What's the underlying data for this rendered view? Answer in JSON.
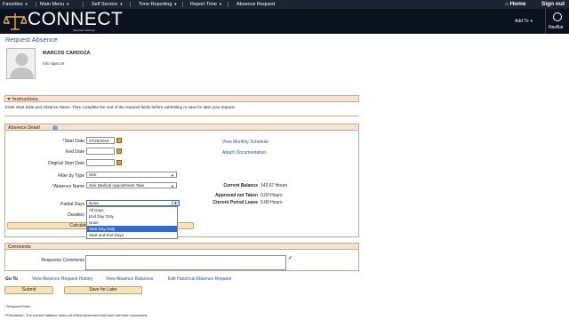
{
  "topnav": {
    "menus": [
      "Favorites",
      "Main Menu",
      "Self Service",
      "Time Reporting",
      "Report Time",
      "Absence Request"
    ],
    "home": "Home",
    "signout": "Sign out"
  },
  "header": {
    "logo": "CONNECT",
    "logo_sub": "Maryland Judiciary",
    "add_to": "Add To",
    "navbar": "NavBar"
  },
  "page_title": "Request Absence",
  "employee": {
    "name": "MARCOS CARDOZA",
    "job": "Info Spec IX"
  },
  "instructions": {
    "title": "Instructions",
    "text": "Enter Start Date and Absence Name. Then complete the rest of the required fields before submitting or save for later your request."
  },
  "absence_detail": {
    "title": "Absence Detail",
    "start_date_label": "*Start Date",
    "start_date_value": "07/26/2018",
    "end_date_label": "End Date",
    "original_start_label": "Original Start Date",
    "filter_label": "Filter by Type",
    "filter_value": "Sick",
    "absence_name_label": "*Absence Name",
    "absence_name_value": "Sick Medical Appointment Take",
    "partial_days_label": "Partial Days",
    "partial_days_value": "None",
    "duration_label": "Duration",
    "calc_button": "Calculate End Date or Duration",
    "view_monthly": "View Monthly Schedule",
    "attach_doc": "Attach Documentation",
    "current_balance_label": "Current Balance",
    "current_balance_value": "143.67 Hours",
    "approved_label": "Approved not Taken",
    "approved_value": "0.00 Hours",
    "current_leave_label": "Current Period Leave",
    "current_leave_value": "0.00 Hours",
    "dropdown_options": [
      "All Days",
      "End Day Only",
      "None",
      "Start Day Only",
      "Start and End Days"
    ],
    "dropdown_highlighted": "Start Day Only"
  },
  "comments": {
    "title": "Comments",
    "requestor_label": "Requestor Comments"
  },
  "goto": {
    "label": "Go To",
    "link1": "View Absence Request History",
    "link2": "View Absence Balances",
    "link3": "Edit Historical Absence Request"
  },
  "buttons": {
    "submit": "Submit",
    "save": "Save for Later"
  },
  "footer": {
    "required": "* Required Field",
    "disclaimer": "**Disclaimer: The current balance does not reflect absences that have not been processed."
  }
}
